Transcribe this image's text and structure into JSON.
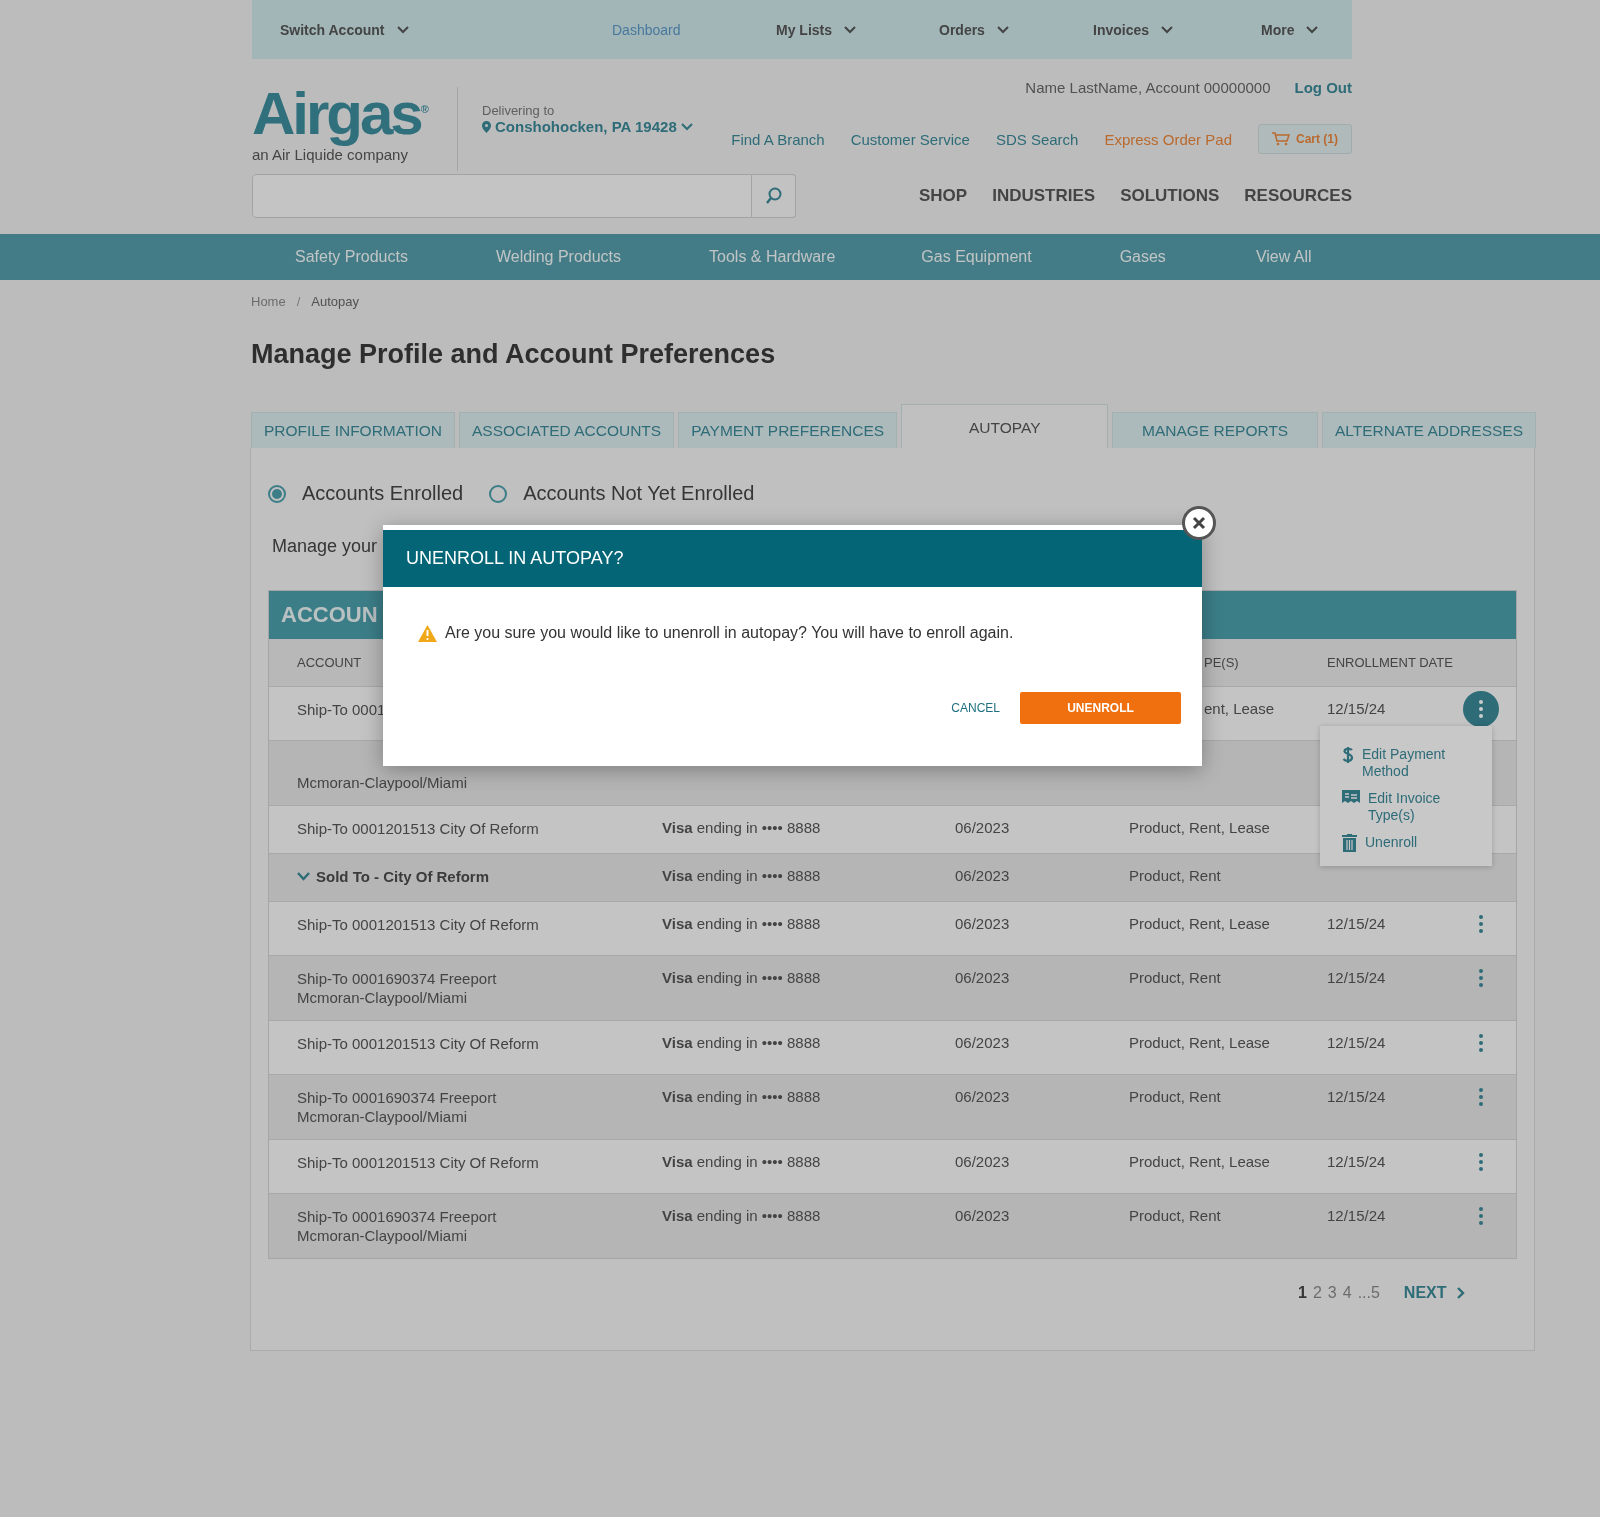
{
  "top_bar": {
    "items": [
      {
        "label": "Switch Account",
        "dropdown": true,
        "selected": false
      },
      {
        "label": "Dashboard",
        "dropdown": false,
        "selected": true
      },
      {
        "label": "My Lists",
        "dropdown": true,
        "selected": false
      },
      {
        "label": "Orders",
        "dropdown": true,
        "selected": false
      },
      {
        "label": "Invoices",
        "dropdown": true,
        "selected": false
      },
      {
        "label": "More",
        "dropdown": true,
        "selected": false
      }
    ]
  },
  "header": {
    "logo": "Airgas$^{®}$",
    "tagline": "an Air Liquide company",
    "delivering_label": "Delivering to",
    "location": "Conshohocken, PA 19428",
    "user": "Name LastName, Account 00000000",
    "logout": "Log Out",
    "links": [
      {
        "label": "Find A Branch",
        "kind": "plain"
      },
      {
        "label": "Customer Service",
        "kind": "plain"
      },
      {
        "label": "SDS Search",
        "kind": "plain"
      },
      {
        "label": "Express Order Pad",
        "kind": "accent"
      }
    ],
    "cart": "Cart (1)",
    "main_menu": [
      "SHOP",
      "INDUSTRIES",
      "SOLUTIONS",
      "RESOURCES"
    ]
  },
  "category_nav": [
    "Safety Products",
    "Welding Products",
    "Tools & Hardware",
    "Gas Equipment",
    "Gases",
    "View All"
  ],
  "breadcrumb": {
    "items": [
      "Home",
      "Autopay"
    ],
    "separator": "/"
  },
  "page_title": "Manage Profile and Account Preferences",
  "tabs": [
    {
      "label": "PROFILE INFORMATION",
      "selected": false
    },
    {
      "label": "ASSOCIATED ACCOUNTS",
      "selected": false
    },
    {
      "label": "PAYMENT PREFERENCES",
      "selected": false
    },
    {
      "label": "AUTOPAY",
      "selected": true
    },
    {
      "label": "MANAGE REPORTS",
      "selected": false
    },
    {
      "label": "ALTERNATE ADDRESSES",
      "selected": false
    }
  ],
  "radios": [
    {
      "label": "Accounts Enrolled",
      "selected": true
    },
    {
      "label": "Accounts Not Yet Enrolled",
      "selected": false
    }
  ],
  "intro": "Manage your",
  "table": {
    "title": "ACCOUN",
    "columns": {
      "column_1": "ACCOUNT",
      "column_4": "PE(S)",
      "column_5": "ENROLLMENT DATE"
    },
    "rows": [
      {
        "kind": "ship",
        "account": "Ship-To 0001",
        "types": "ent, Lease",
        "date": "12/15/24",
        "menu_open": true
      },
      {
        "kind": "covered",
        "account": "Mcmoran-Claypool/Miami"
      },
      {
        "kind": "ship",
        "account": "Ship-To 0001201513 City Of Reform",
        "payment": "**Visa** ending in •••• 8888",
        "expiration": "06/2023",
        "types": "Product, Rent, Lease"
      },
      {
        "kind": "group",
        "expanded": true,
        "account": "Sold To - City Of Reform",
        "payment": "**Visa** ending in •••• 8888",
        "expiration": "06/2023",
        "types": "Product, Rent"
      },
      {
        "kind": "ship",
        "account": "Ship-To 0001201513 City Of Reform",
        "payment": "**Visa** ending in •••• 8888",
        "expiration": "06/2023",
        "types": "Product, Rent, Lease",
        "date": "12/15/24",
        "menu_open": false
      },
      {
        "kind": "ship",
        "account": "Ship-To 0001690374 Freeport Mcmoran-Claypool/Miami",
        "payment": "**Visa** ending in •••• 8888",
        "expiration": "06/2023",
        "types": "Product, Rent",
        "date": "12/15/24",
        "menu_open": false
      },
      {
        "kind": "ship",
        "account": "Ship-To 0001201513 City Of Reform",
        "payment": "**Visa** ending in •••• 8888",
        "expiration": "06/2023",
        "types": "Product, Rent, Lease",
        "date": "12/15/24",
        "menu_open": false
      },
      {
        "kind": "ship",
        "account": "Ship-To 0001690374 Freeport Mcmoran-Claypool/Miami",
        "payment": "**Visa** ending in •••• 8888",
        "expiration": "06/2023",
        "types": "Product, Rent",
        "date": "12/15/24",
        "menu_open": false
      },
      {
        "kind": "ship",
        "account": "Ship-To 0001201513 City Of Reform",
        "payment": "**Visa** ending in •••• 8888",
        "expiration": "06/2023",
        "types": "Product, Rent, Lease",
        "date": "12/15/24",
        "menu_open": false
      },
      {
        "kind": "ship",
        "account": "Ship-To 0001690374 Freeport Mcmoran-Claypool/Miami",
        "payment": "**Visa** ending in •••• 8888",
        "expiration": "06/2023",
        "types": "Product, Rent",
        "date": "12/15/24",
        "menu_open": false
      }
    ]
  },
  "row_menu": [
    {
      "label": "Edit Payment Method",
      "kind": "dollar"
    },
    {
      "label": "Edit Invoice Type(s)",
      "kind": "invoice"
    },
    {
      "label": "Unenroll",
      "kind": "trash"
    }
  ],
  "pagination": {
    "pages": [
      {
        "label": "1",
        "selected": true
      },
      {
        "label": "2",
        "selected": false
      },
      {
        "label": "3",
        "selected": false
      },
      {
        "label": "4",
        "selected": false
      },
      {
        "label": "...5",
        "selected": false
      }
    ],
    "next": "NEXT"
  },
  "modal": {
    "title": "UNENROLL IN AUTOPAY?",
    "message": "Are you sure you would like to unenroll in autopay? You will have to enroll again.",
    "cancel": "CANCEL",
    "confirm": "UNENROLL"
  }
}
